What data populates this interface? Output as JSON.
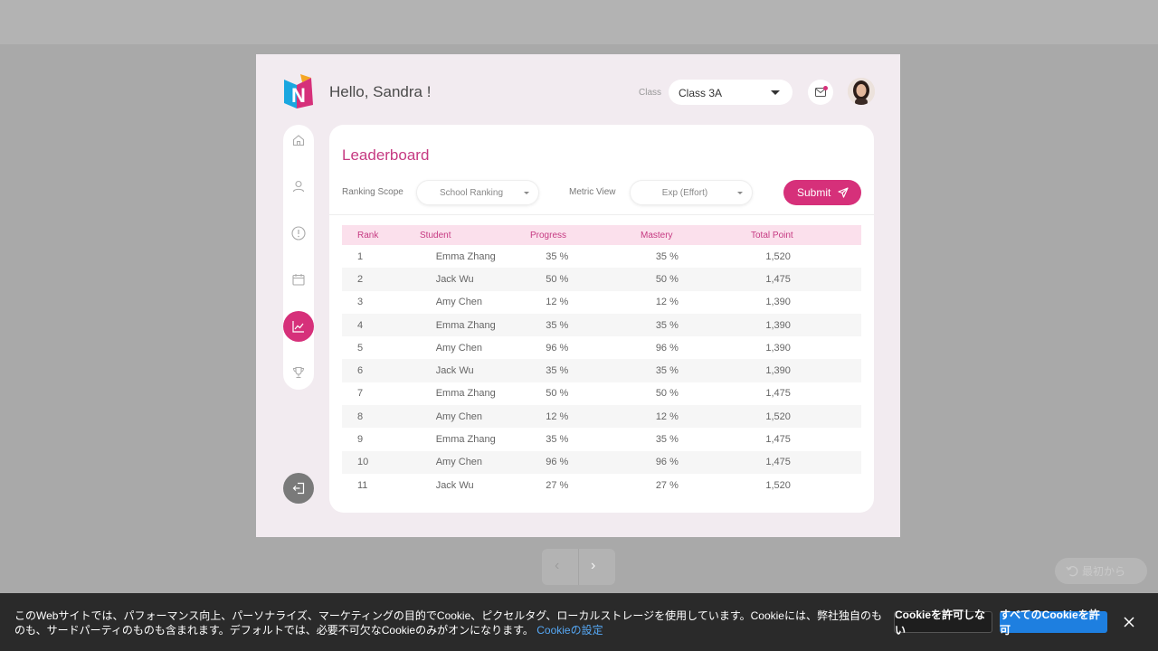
{
  "header": {
    "greeting": "Hello, Sandra !",
    "class_label": "Class",
    "class_value": "Class 3A"
  },
  "sidebar": {
    "items": [
      {
        "name": "home-icon",
        "active": false
      },
      {
        "name": "user-icon",
        "active": false
      },
      {
        "name": "alert-icon",
        "active": false
      },
      {
        "name": "calendar-icon",
        "active": false
      },
      {
        "name": "chart-icon",
        "active": true
      },
      {
        "name": "trophy-icon",
        "active": false
      }
    ]
  },
  "leaderboard": {
    "title": "Leaderboard",
    "ranking_scope_label": "Ranking Scope",
    "ranking_scope_value": "School Ranking",
    "metric_view_label": "Metric View",
    "metric_view_value": "Exp (Effort)",
    "submit_label": "Submit",
    "columns": [
      "Rank",
      "Student",
      "Progress",
      "Mastery",
      "Total Point"
    ],
    "rows": [
      [
        "1",
        "Emma Zhang",
        "35 %",
        "35 %",
        "1,520"
      ],
      [
        "2",
        "Jack Wu",
        "50 %",
        "50 %",
        "1,475"
      ],
      [
        "3",
        "Amy Chen",
        "12 %",
        "12 %",
        "1,390"
      ],
      [
        "4",
        "Emma Zhang",
        "35 %",
        "35 %",
        "1,390"
      ],
      [
        "5",
        "Amy Chen",
        "96 %",
        "96 %",
        "1,390"
      ],
      [
        "6",
        "Jack Wu",
        "35 %",
        "35 %",
        "1,390"
      ],
      [
        "7",
        "Emma Zhang",
        "50 %",
        "50 %",
        "1,475"
      ],
      [
        "8",
        "Amy Chen",
        "12 %",
        "12 %",
        "1,520"
      ],
      [
        "9",
        "Emma Zhang",
        "35 %",
        "35 %",
        "1,475"
      ],
      [
        "10",
        "Amy Chen",
        "96 %",
        "96 %",
        "1,475"
      ],
      [
        "11",
        "Jack Wu",
        "27 %",
        "27 %",
        "1,520"
      ]
    ]
  },
  "player": {
    "prev_symbol": "‹",
    "next_symbol": "›",
    "restart_label": "最初から"
  },
  "cookie_banner": {
    "text": "このWebサイトでは、パフォーマンス向上、パーソナライズ、マーケティングの目的でCookie、ピクセルタグ、ローカルストレージを使用しています。Cookieには、弊社独自のものも、サードパーティのものも含まれます。デフォルトでは、必要不可欠なCookieのみがオンになります。",
    "settings_link": "Cookieの設定",
    "deny_label": "Cookieを許可しない",
    "allow_label": "すべてのCookieを許可"
  },
  "colors": {
    "accent": "#d6307a",
    "frame_bg": "#f2ebf0",
    "header_row": "#fbe0ec",
    "cookie_bg": "#2a2a2a",
    "allow_button": "#1e7fe0"
  }
}
